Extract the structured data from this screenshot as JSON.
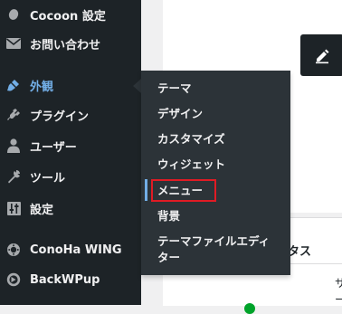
{
  "sidebar": {
    "items": [
      {
        "label": "Cocoon 設定",
        "icon": "circle-icon"
      },
      {
        "label": "お問い合わせ",
        "icon": "envelope-icon"
      },
      {
        "label": "外観",
        "icon": "paintbrush-icon",
        "active": true
      },
      {
        "label": "プラグイン",
        "icon": "plugin-icon"
      },
      {
        "label": "ユーザー",
        "icon": "user-icon"
      },
      {
        "label": "ツール",
        "icon": "wrench-icon"
      },
      {
        "label": "設定",
        "icon": "settings-sliders-icon"
      },
      {
        "label": "ConoHa WING",
        "icon": "conoha-icon"
      },
      {
        "label": "BackWPup",
        "icon": "backwpup-icon"
      }
    ]
  },
  "submenu": {
    "items": [
      {
        "label": "テーマ"
      },
      {
        "label": "デザイン"
      },
      {
        "label": "カスタマイズ"
      },
      {
        "label": "ウィジェット"
      },
      {
        "label": "メニュー",
        "current": true
      },
      {
        "label": "背景"
      },
      {
        "label": "テーマファイルエディター"
      }
    ]
  },
  "content": {
    "status_heading": "タス",
    "info_line1": "サイ",
    "info_line2": "ーマ"
  },
  "colors": {
    "sidebar_bg": "#1d2327",
    "flyout_bg": "#2c3338",
    "active_text": "#72aee6",
    "highlight": "#e01b24",
    "status_dot": "#00a32a"
  }
}
